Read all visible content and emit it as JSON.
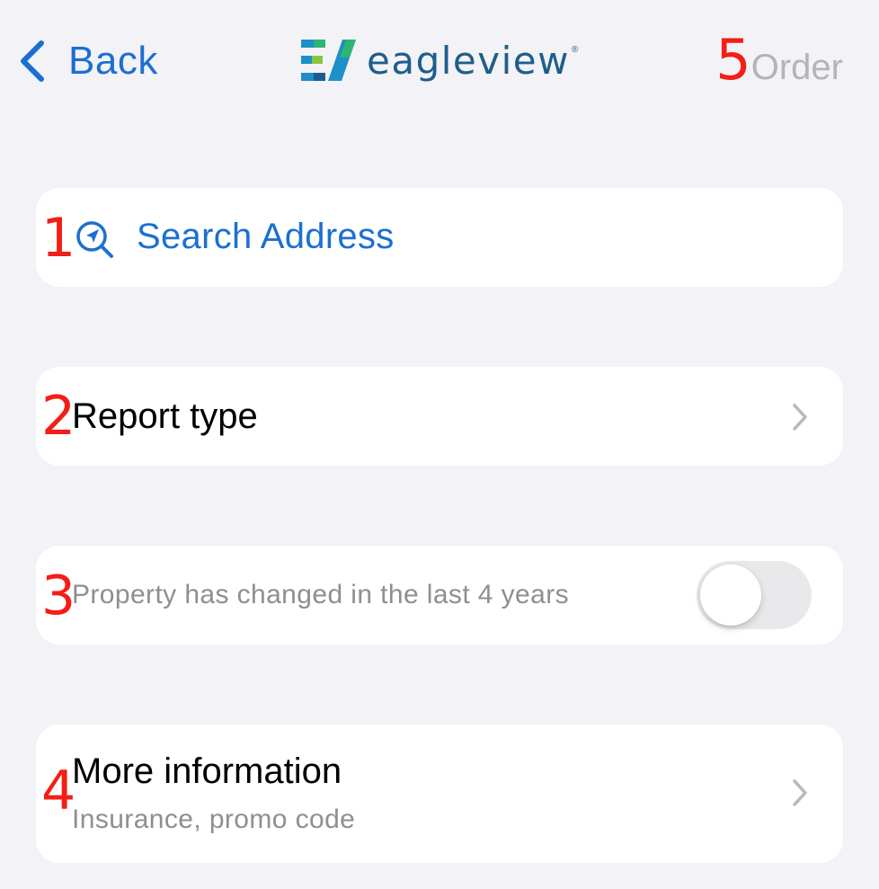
{
  "nav": {
    "back_label": "Back",
    "logo_text": "eagleview",
    "logo_reg": "®",
    "order_marker": "5",
    "order_label": "Order"
  },
  "rows": {
    "search": {
      "marker": "1",
      "label": "Search Address"
    },
    "report_type": {
      "marker": "2",
      "label": "Report type"
    },
    "property_changed": {
      "marker": "3",
      "label": "Property has changed in the last 4 years",
      "toggle_on": false
    },
    "more_info": {
      "marker": "4",
      "title": "More information",
      "subtitle": "Insurance, promo code"
    }
  },
  "colors": {
    "accent": "#1C6FD2",
    "marker": "#F31E16",
    "background": "#F2F2F7",
    "card": "#FFFFFF",
    "secondary_text": "#8E8E93",
    "disabled_text": "#B3B3B8",
    "chevron": "#B8B8BD"
  },
  "icons": {
    "back": "chevron-left-icon",
    "search": "location-search-icon",
    "disclosure": "chevron-right-icon"
  }
}
